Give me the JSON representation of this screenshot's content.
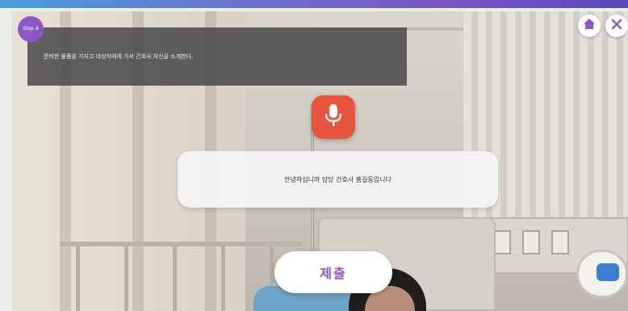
{
  "header": {
    "badge_text": "Step 4"
  },
  "instruction": {
    "text": "준비한 물품을 가지고 대상자에게 가서 간호사 자신을 소개한다."
  },
  "controls": {
    "home_icon": "home-icon",
    "close_icon": "close-icon",
    "mic_icon": "microphone-icon"
  },
  "speech": {
    "text": "안녕하십니까 담당 간호사 홍길동입니다"
  },
  "submit": {
    "label": "제출"
  },
  "colors": {
    "accent_purple": "#8c57c7",
    "mic_red": "#e8553f",
    "overlay_dark": "#484848"
  }
}
